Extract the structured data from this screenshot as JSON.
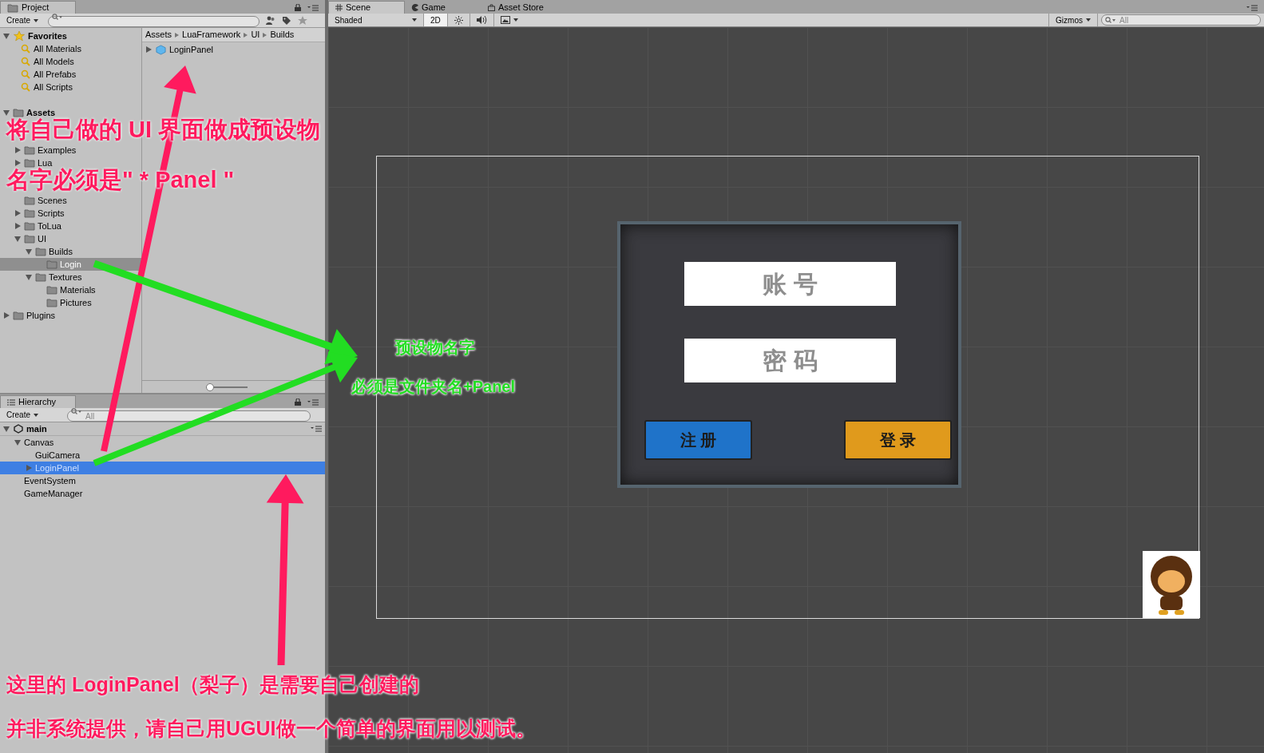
{
  "project": {
    "tab": "Project",
    "create": "Create",
    "breadcrumb": [
      "Assets",
      "LuaFramework",
      "UI",
      "Builds"
    ],
    "favorites": {
      "label": "Favorites",
      "expanded": true,
      "items": [
        "All Materials",
        "All Models",
        "All Prefabs",
        "All Scripts"
      ]
    },
    "tree": [
      {
        "label": "Assets",
        "expanded": true,
        "selected": false,
        "children": [
          {
            "label": "Examples",
            "expanded": false,
            "selected": false
          },
          {
            "label": "Lua",
            "expanded": false,
            "selected": false
          },
          {
            "label": "Scenes",
            "selected": false
          },
          {
            "label": "Scripts",
            "expanded": false,
            "selected": false
          },
          {
            "label": "ToLua",
            "expanded": false,
            "selected": false
          },
          {
            "label": "UI",
            "expanded": true,
            "selected": false,
            "children": [
              {
                "label": "Builds",
                "expanded": true,
                "selected": false,
                "children": [
                  {
                    "label": "Login",
                    "selected": true
                  }
                ]
              },
              {
                "label": "Textures",
                "expanded": true,
                "selected": false,
                "children": [
                  {
                    "label": "Materials",
                    "selected": false
                  },
                  {
                    "label": "Pictures",
                    "selected": false
                  }
                ]
              }
            ]
          }
        ]
      },
      {
        "label": "Plugins",
        "expanded": false,
        "selected": false
      }
    ],
    "files": [
      {
        "name": "LoginPanel"
      }
    ],
    "zoom_slider": {
      "level": 0
    }
  },
  "hierarchy": {
    "tab": "Hierarchy",
    "create": "Create",
    "search": {
      "placeholder": "All"
    },
    "scene": "main",
    "items": [
      {
        "label": "Canvas",
        "expanded": true,
        "selected": false,
        "children": [
          {
            "label": "GuiCamera",
            "selected": false
          },
          {
            "label": "LoginPanel",
            "expanded": false,
            "selected": true
          }
        ]
      },
      {
        "label": "EventSystem",
        "selected": false
      },
      {
        "label": "GameManager",
        "selected": false
      }
    ]
  },
  "scene_view": {
    "tabs": [
      {
        "label": "Scene",
        "selected": true
      },
      {
        "label": "Game",
        "selected": false
      },
      {
        "label": "Asset Store",
        "selected": false
      }
    ],
    "shading": "Shaded",
    "mode_2d": {
      "label": "2D",
      "on": true
    },
    "gizmos": "Gizmos",
    "search": {
      "placeholder": "All"
    },
    "fields": [
      {
        "placeholder": "账 号"
      },
      {
        "placeholder": "密 码"
      }
    ],
    "buttons": [
      {
        "label": "注 册",
        "color": "#1f73c9"
      },
      {
        "label": "登 录",
        "color": "#e09a1c"
      }
    ]
  },
  "annotations": [
    {
      "text": "将自己做的 UI 界面做成预设物",
      "color": "#ff1a5e"
    },
    {
      "text": "名字必须是\" * Panel \"",
      "color": "#ff1a5e"
    },
    {
      "text": "预设物名字",
      "color": "#22dd22"
    },
    {
      "text": "必须是文件夹名+Panel",
      "color": "#22dd22"
    },
    {
      "text": "这里的 LoginPanel（梨子）是需要自己创建的",
      "color": "#ff1a5e"
    },
    {
      "text": "并非系统提供，请自己用UGUI做一个简单的界面用以测试。",
      "color": "#ff1a5e"
    }
  ]
}
